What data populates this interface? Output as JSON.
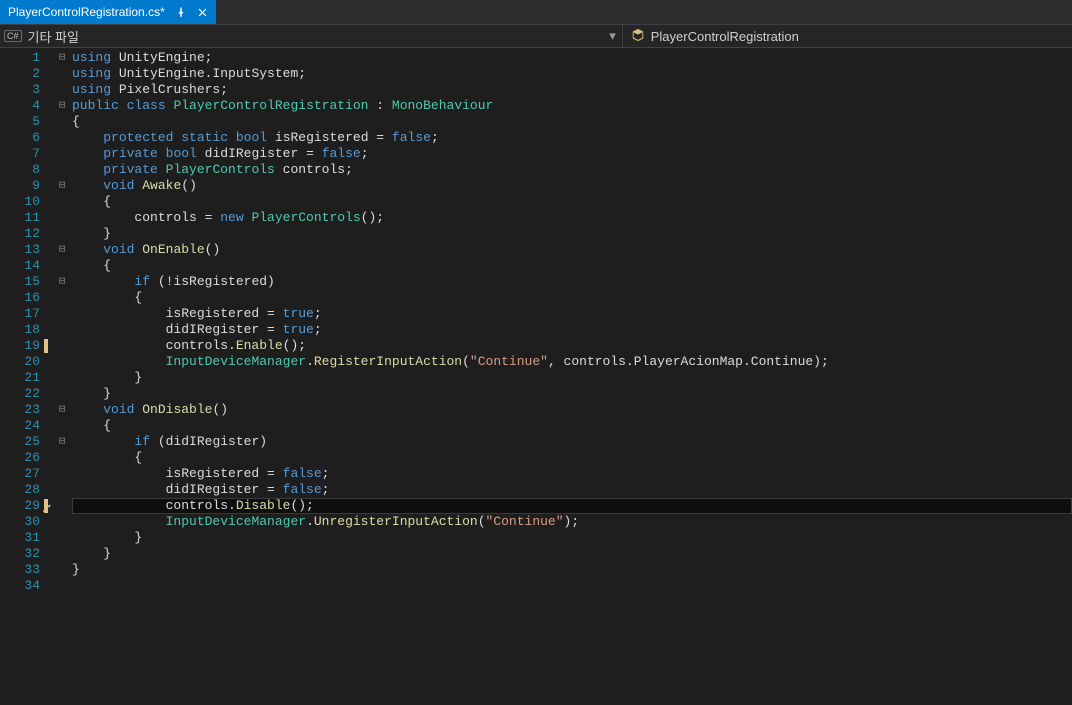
{
  "tab": {
    "filename": "PlayerControlRegistration.cs*"
  },
  "nav": {
    "badge": "C#",
    "project": "기타 파일",
    "class": "PlayerControlRegistration"
  },
  "code": {
    "lines": [
      {
        "n": 1,
        "fold": "-",
        "html": "<span class='kw'>using</span> UnityEngine;"
      },
      {
        "n": 2,
        "fold": "",
        "html": "<span class='kw'>using</span> UnityEngine.InputSystem;"
      },
      {
        "n": 3,
        "fold": "",
        "html": "<span class='kw'>using</span> PixelCrushers;"
      },
      {
        "n": 4,
        "fold": "-",
        "html": "<span class='kw'>public</span> <span class='kw'>class</span> <span class='type'>PlayerControlRegistration</span> : <span class='type'>MonoBehaviour</span>"
      },
      {
        "n": 5,
        "fold": "",
        "html": "{"
      },
      {
        "n": 6,
        "fold": "",
        "html": "    <span class='kw'>protected</span> <span class='kw'>static</span> <span class='kw'>bool</span> isRegistered = <span class='kw'>false</span>;"
      },
      {
        "n": 7,
        "fold": "",
        "html": "    <span class='kw'>private</span> <span class='kw'>bool</span> didIRegister = <span class='kw'>false</span>;"
      },
      {
        "n": 8,
        "fold": "",
        "html": "    <span class='kw'>private</span> <span class='type'>PlayerControls</span> controls;"
      },
      {
        "n": 9,
        "fold": "-",
        "html": "    <span class='kw'>void</span> <span class='mname'>Awake</span>()"
      },
      {
        "n": 10,
        "fold": "",
        "html": "    {"
      },
      {
        "n": 11,
        "fold": "",
        "html": "        controls = <span class='kw'>new</span> <span class='type'>PlayerControls</span>();"
      },
      {
        "n": 12,
        "fold": "",
        "html": "    }"
      },
      {
        "n": 13,
        "fold": "-",
        "html": "    <span class='kw'>void</span> <span class='mname'>OnEnable</span>()"
      },
      {
        "n": 14,
        "fold": "",
        "html": "    {"
      },
      {
        "n": 15,
        "fold": "-",
        "html": "        <span class='kw'>if</span> (!isRegistered)"
      },
      {
        "n": 16,
        "fold": "",
        "html": "        {"
      },
      {
        "n": 17,
        "fold": "",
        "html": "            isRegistered = <span class='kw'>true</span>;"
      },
      {
        "n": 18,
        "fold": "",
        "html": "            didIRegister = <span class='kw'>true</span>;"
      },
      {
        "n": 19,
        "fold": "",
        "html": "            controls.<span class='mname'>Enable</span>();",
        "changed": true
      },
      {
        "n": 20,
        "fold": "",
        "html": "            <span class='type'>InputDeviceManager</span>.<span class='mname'>RegisterInputAction</span>(<span class='str'>\"Continue\"</span>, controls.PlayerAcionMap.Continue);"
      },
      {
        "n": 21,
        "fold": "",
        "html": "        }"
      },
      {
        "n": 22,
        "fold": "",
        "html": "    }"
      },
      {
        "n": 23,
        "fold": "-",
        "html": "    <span class='kw'>void</span> <span class='mname'>OnDisable</span>()"
      },
      {
        "n": 24,
        "fold": "",
        "html": "    {"
      },
      {
        "n": 25,
        "fold": "-",
        "html": "        <span class='kw'>if</span> (didIRegister)"
      },
      {
        "n": 26,
        "fold": "",
        "html": "        {"
      },
      {
        "n": 27,
        "fold": "",
        "html": "            isRegistered = <span class='kw'>false</span>;"
      },
      {
        "n": 28,
        "fold": "",
        "html": "            didIRegister = <span class='kw'>false</span>;"
      },
      {
        "n": 29,
        "fold": "",
        "html": "            controls.<span class='mname'>Disable</span>();",
        "changed": true,
        "screw": true,
        "hl": true
      },
      {
        "n": 30,
        "fold": "",
        "html": "            <span class='type'>InputDeviceManager</span>.<span class='mname'>UnregisterInputAction</span>(<span class='str'>\"Continue\"</span>);"
      },
      {
        "n": 31,
        "fold": "",
        "html": "        }"
      },
      {
        "n": 32,
        "fold": "",
        "html": "    }"
      },
      {
        "n": 33,
        "fold": "",
        "html": "}"
      },
      {
        "n": 34,
        "fold": "",
        "html": ""
      }
    ]
  }
}
